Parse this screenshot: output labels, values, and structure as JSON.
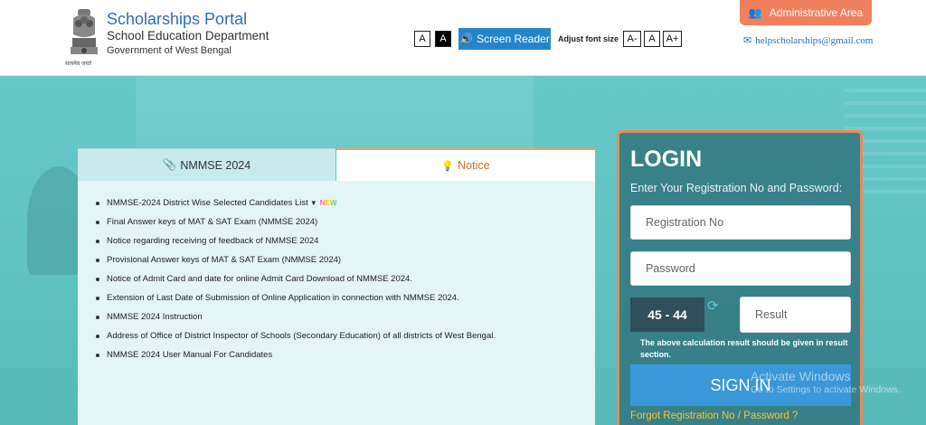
{
  "header": {
    "title": "Scholarships Portal",
    "department": "School Education Department",
    "government": "Government of West Bengal",
    "emblem_motto": "सत्यमेव जयते",
    "contrast_normal": "A",
    "contrast_dark": "A",
    "screen_reader": "Screen Reader",
    "adjust_font_label": "Adjust font size",
    "font_decrease": "A-",
    "font_normal": "A",
    "font_increase": "A+",
    "admin_label": "Administrative Area",
    "email": "helpscholarships@gmail.com"
  },
  "tabs": {
    "nmmse": "NMMSE 2024",
    "notice": "Notice"
  },
  "notices": [
    "NMMSE-2024 District Wise Selected Candidates List",
    "Final Answer keys of MAT & SAT Exam (NMMSE 2024)",
    "Notice regarding receiving of feedback of NMMSE 2024",
    "Provisional Answer keys of MAT & SAT Exam (NMMSE 2024)",
    "Notice of Admit Card and date for online Admit Card Download of NMMSE 2024.",
    "Extension of Last Date of Submission of Online Application in connection with NMMSE 2024.",
    "NMMSE 2024 Instruction",
    "Address of Office of District Inspector of Schools (Secondary Education) of all districts of West Bengal.",
    "NMMSE 2024 User Manual For Candidates"
  ],
  "new_badge": "NEW",
  "login": {
    "title": "LOGIN",
    "subtitle": "Enter Your Registration No and Password:",
    "registration_placeholder": "Registration No",
    "password_placeholder": "Password",
    "captcha": "45 - 44",
    "result_placeholder": "Result",
    "note": "The above calculation result should be given in result section.",
    "sign_in": "SIGN IN",
    "forgot": "Forgot Registration No / Password ?"
  },
  "watermark": {
    "line1": "Activate Windows",
    "line2": "Go to Settings to activate Windows."
  },
  "colors": {
    "brand_blue": "#2d6fb5",
    "admin_orange": "#f0805e",
    "screen_reader_blue": "#2685c9",
    "hero_teal": "#5fc4c4",
    "sign_in_blue": "#3a97d8",
    "forgot_yellow": "#f5c13c",
    "notice_orange": "#c8702c"
  }
}
